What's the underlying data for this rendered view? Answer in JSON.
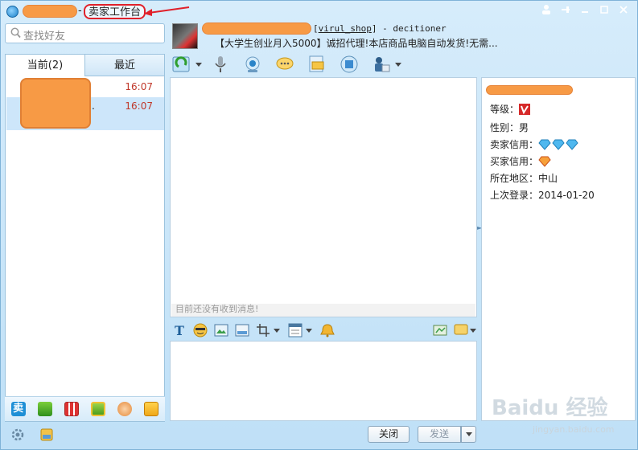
{
  "window": {
    "title_separator": "-",
    "title": "卖家工作台",
    "buttons": [
      "user-icon",
      "pin-icon",
      "minimize-icon",
      "maximize-icon",
      "close-icon"
    ]
  },
  "search": {
    "placeholder": "查找好友"
  },
  "contacts": {
    "tabs": [
      {
        "label": "当前(2)"
      },
      {
        "label": "最近"
      }
    ],
    "rows": [
      {
        "time": "16:07"
      },
      {
        "time": "16:07",
        "suffix": "."
      }
    ]
  },
  "chat": {
    "shop_prefix": "[",
    "shop_link": "virul_shop",
    "shop_suffix": "] - decitioner",
    "signature": "【大学生创业月入5000】诚招代理!本店商品电脑自动发货!无需...",
    "empty_message": "目前还没有收到消息!",
    "close_label": "关闭",
    "send_label": "发送"
  },
  "info": {
    "rows": [
      {
        "label": "等级：",
        "value": ""
      },
      {
        "label": "性别：",
        "value": "男"
      },
      {
        "label": "卖家信用：",
        "value": ""
      },
      {
        "label": "买家信用：",
        "value": ""
      },
      {
        "label": "所在地区：",
        "value": "中山"
      },
      {
        "label": "上次登录：",
        "value": "2014-01-20"
      }
    ]
  },
  "watermark": {
    "brand": "Baidu 经验",
    "url": "jingyan.baidu.com"
  },
  "colors": {
    "accent": "#1b7fc8",
    "redact": "#f79a45",
    "highlight": "#e0202a",
    "time": "#c0392b"
  }
}
